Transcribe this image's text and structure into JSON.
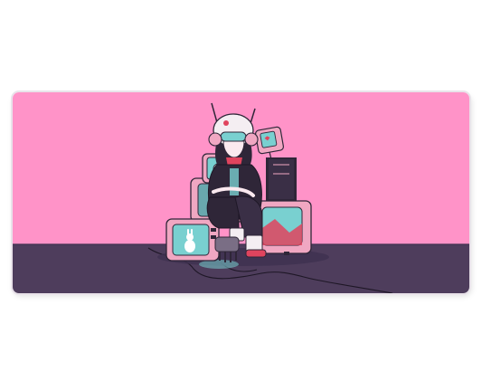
{
  "scene": {
    "subject": "",
    "colors": {
      "wall": "#ff93c8",
      "floor": "#4e3d5c",
      "floor_shadow": "#3f3150",
      "edge": "#e9e3ea",
      "tv_body": "#f0a7c2",
      "tv_dark": "#3a2f46",
      "screen": "#79d0d0",
      "jacket": "#2f2638",
      "helmet": "#f4eef2",
      "accent_red": "#e0445e",
      "cable": "#1e1726"
    }
  }
}
